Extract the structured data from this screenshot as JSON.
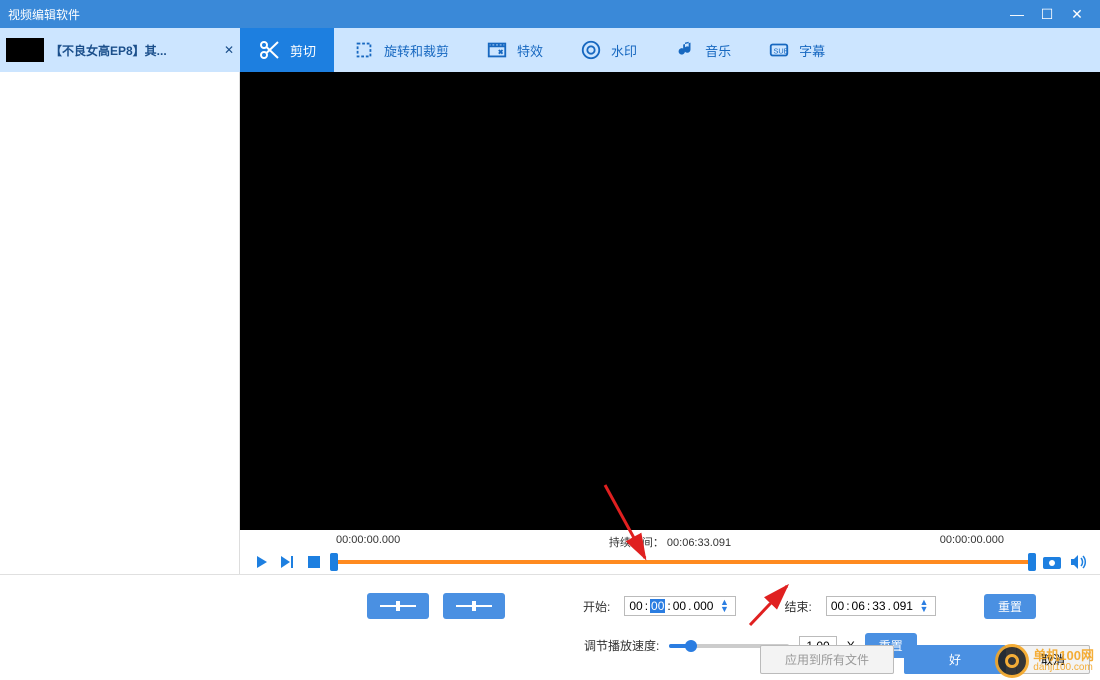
{
  "window": {
    "title": "视频编辑软件"
  },
  "file": {
    "name": "【不良女高EP8】其..."
  },
  "tabs": {
    "cut": "剪切",
    "rotate": "旋转和裁剪",
    "effect": "特效",
    "watermark": "水印",
    "music": "音乐",
    "subtitle": "字幕"
  },
  "timeline": {
    "start_label": "00:00:00.000",
    "duration_label": "持续时间：",
    "duration_value": "00:06:33.091",
    "end_label": "00:00:00.000"
  },
  "trim": {
    "start_label": "开始:",
    "start_h": "00",
    "start_m": "00",
    "start_sel": "00",
    "start_s": "00",
    "start_ms": "000",
    "end_label": "结束:",
    "end_h": "00",
    "end_m": "06",
    "end_s": "33",
    "end_ms": "091",
    "reset": "重置"
  },
  "speed": {
    "label": "调节播放速度:",
    "value": "1.00",
    "x": "X",
    "reset": "重置"
  },
  "footer": {
    "apply_all": "应用到所有文件",
    "ok": "好",
    "cancel": "取消"
  },
  "watermark": {
    "text": "单机100网",
    "sub": "danji100.com"
  }
}
